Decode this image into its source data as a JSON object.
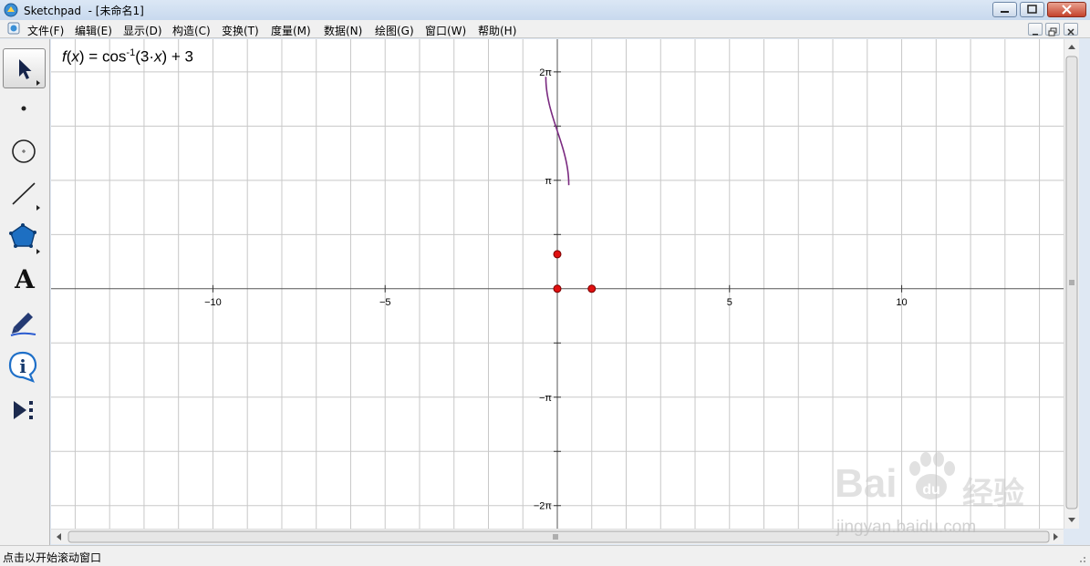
{
  "window": {
    "title": "Sketchpad  - [未命名1]",
    "title_bar_color": "#c8d9ee"
  },
  "menu": [
    {
      "label": "文件(F)"
    },
    {
      "label": "编辑(E)"
    },
    {
      "label": "显示(D)"
    },
    {
      "label": "构造(C)"
    },
    {
      "label": "变换(T)"
    },
    {
      "label": "度量(M)"
    },
    {
      "label": "数据(N)"
    },
    {
      "label": "绘图(G)"
    },
    {
      "label": "窗口(W)"
    },
    {
      "label": "帮助(H)"
    }
  ],
  "toolbox": {
    "tools": [
      {
        "name": "arrow-select-tool",
        "icon": "arrow-icon",
        "active": true
      },
      {
        "name": "point-tool",
        "icon": "point-icon"
      },
      {
        "name": "compass-tool",
        "icon": "circle-icon"
      },
      {
        "name": "straightedge-tool",
        "icon": "segment-icon"
      },
      {
        "name": "polygon-tool",
        "icon": "pentagon-icon"
      },
      {
        "name": "text-tool",
        "icon": "text-a-icon",
        "label": "A"
      },
      {
        "name": "marker-tool",
        "icon": "marker-icon"
      },
      {
        "name": "information-tool",
        "icon": "info-icon"
      },
      {
        "name": "custom-tool",
        "icon": "play-more-icon"
      }
    ]
  },
  "graph": {
    "function": {
      "name": "f",
      "var": "x",
      "rhs_prefix": " = cos",
      "superscript": "-1",
      "arg_open": "(3·",
      "arg_var": "x",
      "arg_close": ") + 3"
    },
    "x_tick_labels": [
      {
        "value": -10,
        "text": "−10"
      },
      {
        "value": -5,
        "text": "−5"
      },
      {
        "value": 5,
        "text": "5"
      },
      {
        "value": 10,
        "text": "10"
      }
    ],
    "y_tick_labels": [
      {
        "value": 6.2832,
        "text": "2π"
      },
      {
        "value": 3.1416,
        "text": "π"
      },
      {
        "value": -3.1416,
        "text": "−π"
      },
      {
        "value": -6.2832,
        "text": "−2π"
      }
    ],
    "x_range": [
      -14.7,
      14.7
    ],
    "y_range": [
      -6.95,
      7.23
    ],
    "grid": true,
    "grid_color": "#c8c8c8",
    "curve_color": "#7a2a80",
    "points": [
      {
        "x": 0,
        "y": 0
      },
      {
        "x": 1,
        "y": 0
      },
      {
        "x": 0,
        "y": 1
      }
    ],
    "point_color": "#e01010"
  },
  "status": {
    "text": "点击以开始滚动窗口"
  },
  "watermark": {
    "logo": "Bai",
    "logo2": "经验",
    "url": "jingyan.baidu.com"
  }
}
